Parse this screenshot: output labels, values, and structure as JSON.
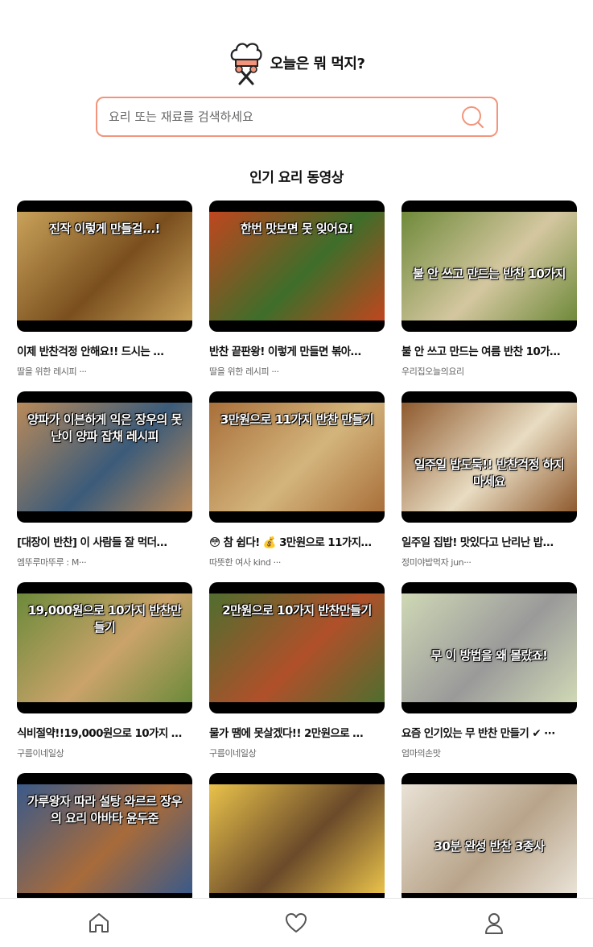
{
  "header": {
    "title": "오늘은 뭐 먹지?",
    "logo_icon": "chef-hat-icon"
  },
  "search": {
    "placeholder": "요리 또는 재료를 검색하세요",
    "value": "",
    "accent_color": "#F2957C"
  },
  "section": {
    "title": "인기 요리 동영상"
  },
  "videos": [
    {
      "title": "이제 반찬걱정 안해요!! 드시는 …",
      "channel": "딸을 위한 레시피 ···",
      "thumb_text": "진작 이렇게 만들걸...!",
      "palette": [
        "#c9a25a",
        "#7a4f1e"
      ]
    },
    {
      "title": "반찬 끝판왕! 이렇게 만들면 볶아…",
      "channel": "딸을 위한 레시피 ···",
      "thumb_text": "한번 맛보면 못 잊어요!",
      "palette": [
        "#c0461f",
        "#3e6e2a"
      ]
    },
    {
      "title": "불 안 쓰고 만드는 여름 반찬 10가…",
      "channel": "우리집오늘의요리",
      "thumb_text": "불 안 쓰고 만드는 반찬 10가지",
      "palette": [
        "#6f8a3a",
        "#d4c7a0"
      ]
    },
    {
      "title": "[대장이 반찬] 이 사람들 잘 먹더…",
      "channel": "엠뚜루마뚜루 : M···",
      "thumb_text": "양파가 이븐하게 익은 장우의 못난이 양파 잡채 레시피",
      "palette": [
        "#b98a5a",
        "#3b5b7a"
      ]
    },
    {
      "title": "😳 참 쉽다! 💰 3만원으로 11가지…",
      "channel": "따뜻한 여사 kind ···",
      "thumb_text": "3만원으로 11가지 반찬 만들기",
      "palette": [
        "#a96f3a",
        "#d3b57c"
      ]
    },
    {
      "title": "일주일 집밥! 맛있다고 난리난 밥…",
      "channel": "정미야밥먹자 jun···",
      "thumb_text": "일주일 밥도둑!! 반찬걱정 하지 마세요",
      "palette": [
        "#8f5a2e",
        "#e8dcc2"
      ]
    },
    {
      "title": "식비절약!!19,000원으로 10가지 …",
      "channel": "구름이네일상",
      "thumb_text": "19,000원으로 10가지 반찬만들기",
      "palette": [
        "#6c8a3a",
        "#caa36a"
      ]
    },
    {
      "title": "물가 땜에 못살겠다!! 2만원으로 …",
      "channel": "구름이네일상",
      "thumb_text": "2만원으로 10가지 반찬만들기",
      "palette": [
        "#4f6e2f",
        "#b0502a"
      ]
    },
    {
      "title": "요즘 인기있는 무 반찬 만들기 ✔ ···",
      "channel": "엄마의손맛",
      "thumb_text": "무 이 방법을 왜 몰랐죠!",
      "palette": [
        "#cfd8b5",
        "#9a9a9a"
      ]
    },
    {
      "title": "",
      "channel": "",
      "thumb_text": "가루왕자 따라 설탕 와르르 장우의 요리 아바타 윤두준",
      "palette": [
        "#3a5a8a",
        "#a86b3a"
      ]
    },
    {
      "title": "",
      "channel": "",
      "thumb_text": "",
      "palette": [
        "#e9c24a",
        "#6a4a2a"
      ]
    },
    {
      "title": "",
      "channel": "",
      "thumb_text": "30분 완성 반찬 3종사",
      "palette": [
        "#e9e2d6",
        "#b8a48a"
      ]
    }
  ],
  "nav": {
    "home_icon": "home-icon",
    "favorites_icon": "heart-icon",
    "profile_icon": "user-icon"
  }
}
